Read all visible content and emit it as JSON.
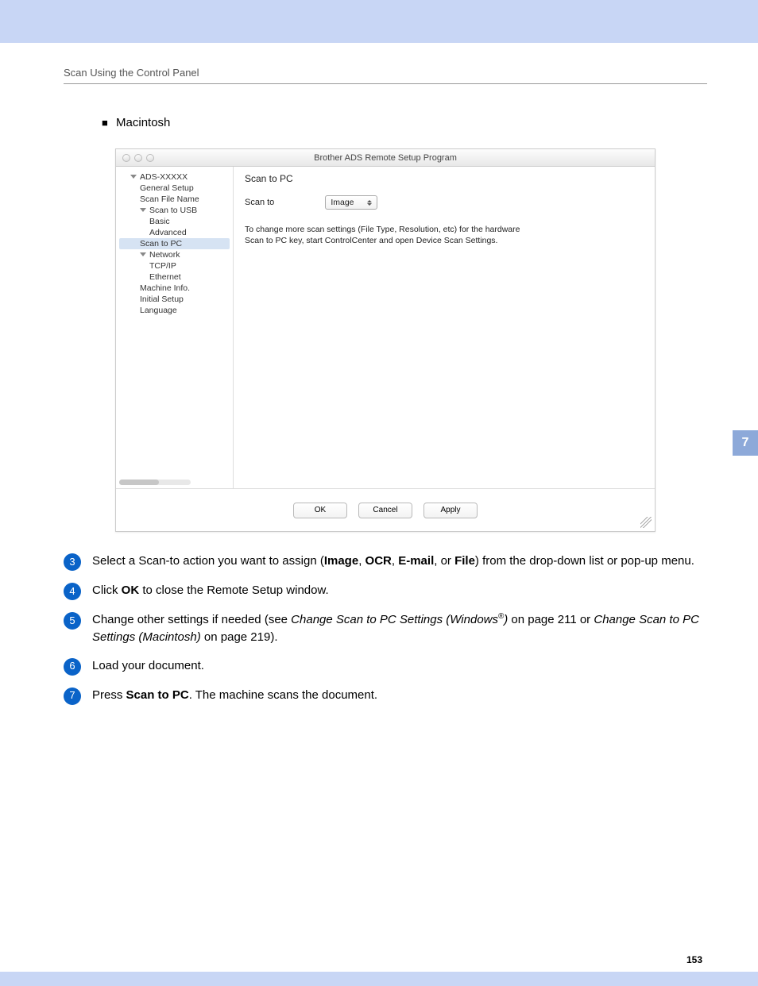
{
  "page": {
    "header": "Scan Using the Control Panel",
    "section_heading": "Macintosh",
    "chapter_tab": "7",
    "page_number": "153"
  },
  "screenshot": {
    "window_title": "Brother ADS Remote Setup Program",
    "tree": {
      "root": "ADS-XXXXX",
      "items": [
        {
          "label": "General Setup",
          "level": 2
        },
        {
          "label": "Scan File Name",
          "level": 2
        },
        {
          "label": "Scan to USB",
          "level": 2,
          "expandable": true
        },
        {
          "label": "Basic",
          "level": 3
        },
        {
          "label": "Advanced",
          "level": 3
        },
        {
          "label": "Scan to PC",
          "level": 2,
          "selected": true
        },
        {
          "label": "Network",
          "level": 2,
          "expandable": true
        },
        {
          "label": "TCP/IP",
          "level": 3
        },
        {
          "label": "Ethernet",
          "level": 3
        },
        {
          "label": "Machine Info.",
          "level": 2
        },
        {
          "label": "Initial Setup",
          "level": 2
        },
        {
          "label": "Language",
          "level": 2
        }
      ]
    },
    "content": {
      "title": "Scan to PC",
      "field_label": "Scan to",
      "field_value": "Image",
      "hint_line1": "To change more scan settings (File Type, Resolution, etc) for the hardware",
      "hint_line2": "Scan to PC key, start ControlCenter and open Device Scan Settings."
    },
    "buttons": {
      "ok": "OK",
      "cancel": "Cancel",
      "apply": "Apply"
    }
  },
  "steps": {
    "s3": {
      "num": "3",
      "t1": "Select a Scan-to action you want to assign (",
      "b1": "Image",
      "c1": ", ",
      "b2": "OCR",
      "c2": ", ",
      "b3": "E-mail",
      "c3": ", or ",
      "b4": "File",
      "t2": ") from the drop-down list or pop-up menu."
    },
    "s4": {
      "num": "4",
      "t1": "Click ",
      "b1": "OK",
      "t2": " to close the Remote Setup window."
    },
    "s5": {
      "num": "5",
      "t1": "Change other settings if needed (see ",
      "i1": "Change Scan to PC Settings (Windows",
      "sup": "®",
      "i1b": ")",
      "t2": " on page 211 or ",
      "i2": "Change Scan to PC Settings (Macintosh)",
      "t3": " on page 219)."
    },
    "s6": {
      "num": "6",
      "t1": "Load your document."
    },
    "s7": {
      "num": "7",
      "t1": "Press ",
      "b1": "Scan to PC",
      "t2": ". The machine scans the document."
    }
  }
}
